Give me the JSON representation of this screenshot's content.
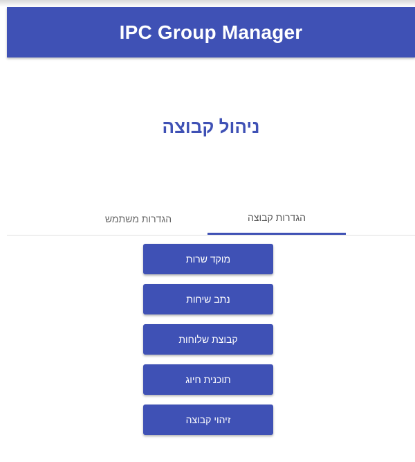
{
  "header": {
    "title": "IPC Group Manager"
  },
  "page": {
    "title": "ניהול קבוצה"
  },
  "tabs": [
    {
      "label": "הגדרות קבוצה",
      "active": true
    },
    {
      "label": "הגדרות משתמש",
      "active": false
    }
  ],
  "actions": [
    {
      "label": "מוקד שרות"
    },
    {
      "label": "נתב שיחות"
    },
    {
      "label": "קבוצת שלוחות"
    },
    {
      "label": "תוכנית חיוג"
    },
    {
      "label": "זיהוי קבוצה"
    }
  ],
  "colors": {
    "primary": "#3f51b5",
    "background": "#ffffff",
    "tab_divider": "#e0e0e0"
  }
}
